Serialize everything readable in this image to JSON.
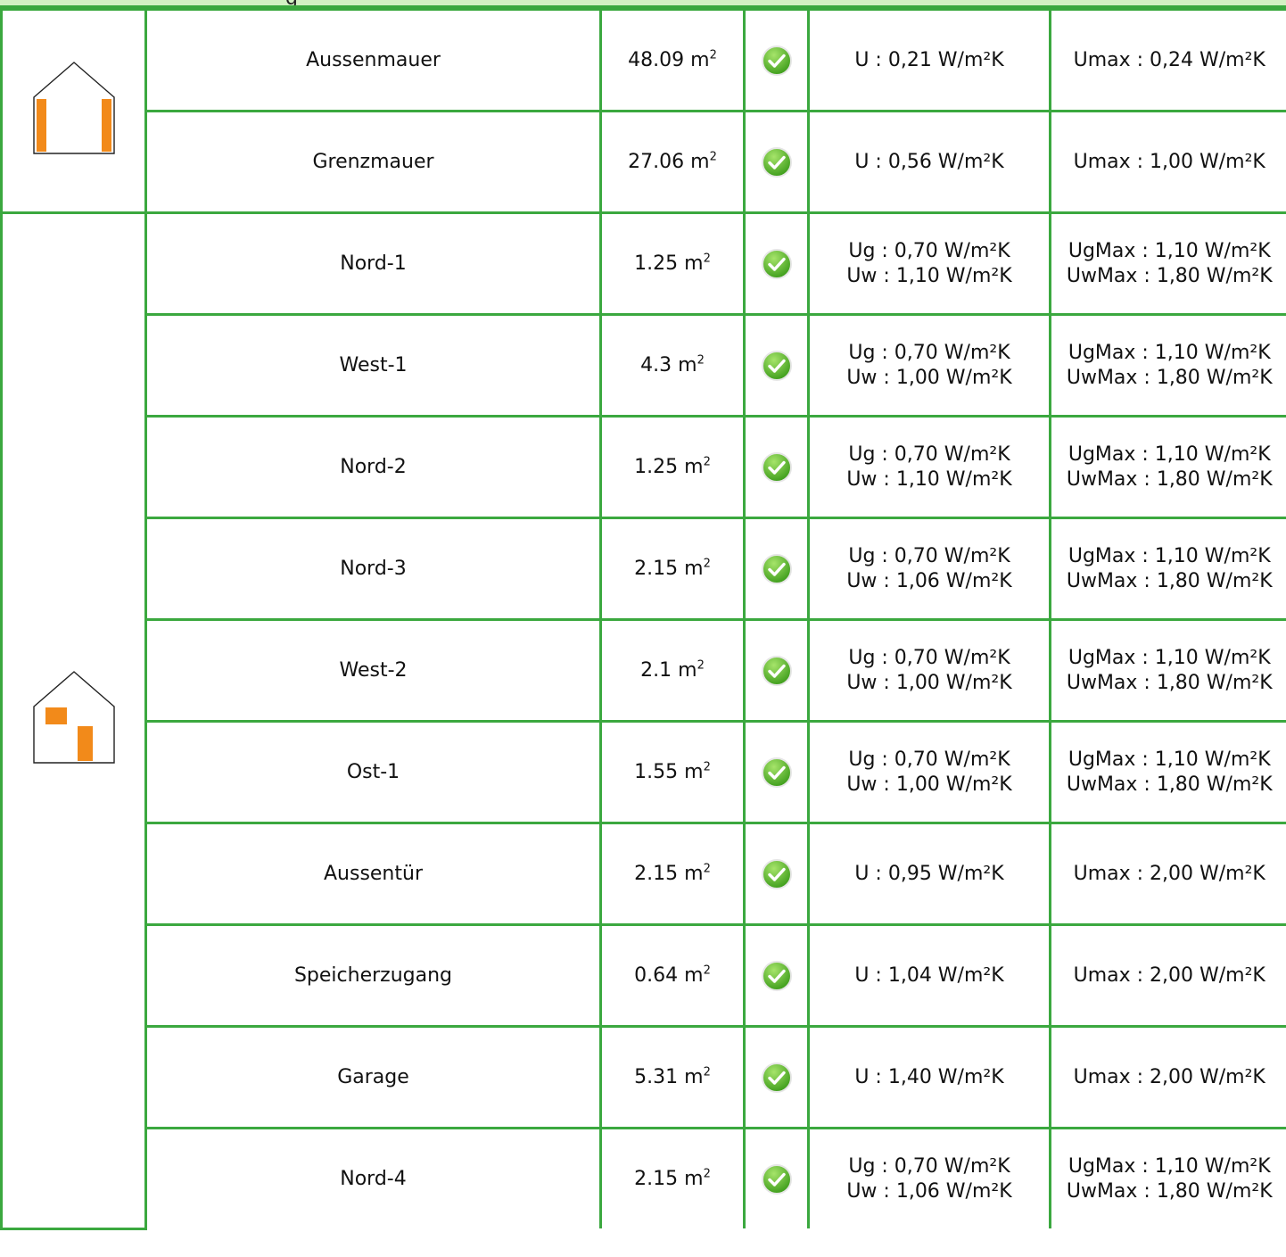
{
  "colors": {
    "grid": "#3ba83f",
    "header_fill": "#d3f1c3",
    "accent_orange": "#f28a1a",
    "check_green": "#5cbf2a"
  },
  "header": {
    "text": "g"
  },
  "groups": [
    {
      "icon": "house-walls-icon",
      "rows": [
        {
          "name": "Aussenmauer",
          "area": "48.09 m",
          "area_unit_sup": "2",
          "value_lines": [
            "U : 0,21 W/m²K"
          ],
          "max_lines": [
            "Umax : 0,24 W/m²K"
          ]
        },
        {
          "name": "Grenzmauer",
          "area": "27.06 m",
          "area_unit_sup": "2",
          "value_lines": [
            "U : 0,56 W/m²K"
          ],
          "max_lines": [
            "Umax : 1,00 W/m²K"
          ]
        }
      ]
    },
    {
      "icon": "house-windows-icon",
      "rows": [
        {
          "name": "Nord-1",
          "area": "1.25 m",
          "area_unit_sup": "2",
          "value_lines": [
            "Ug : 0,70 W/m²K",
            "Uw : 1,10 W/m²K"
          ],
          "max_lines": [
            "UgMax : 1,10 W/m²K",
            "UwMax : 1,80 W/m²K"
          ]
        },
        {
          "name": "West-1",
          "area": "4.3 m",
          "area_unit_sup": "2",
          "value_lines": [
            "Ug : 0,70 W/m²K",
            "Uw : 1,00 W/m²K"
          ],
          "max_lines": [
            "UgMax : 1,10 W/m²K",
            "UwMax : 1,80 W/m²K"
          ]
        },
        {
          "name": "Nord-2",
          "area": "1.25 m",
          "area_unit_sup": "2",
          "value_lines": [
            "Ug : 0,70 W/m²K",
            "Uw : 1,10 W/m²K"
          ],
          "max_lines": [
            "UgMax : 1,10 W/m²K",
            "UwMax : 1,80 W/m²K"
          ]
        },
        {
          "name": "Nord-3",
          "area": "2.15 m",
          "area_unit_sup": "2",
          "value_lines": [
            "Ug : 0,70 W/m²K",
            "Uw : 1,06 W/m²K"
          ],
          "max_lines": [
            "UgMax : 1,10 W/m²K",
            "UwMax : 1,80 W/m²K"
          ]
        },
        {
          "name": "West-2",
          "area": "2.1 m",
          "area_unit_sup": "2",
          "value_lines": [
            "Ug : 0,70 W/m²K",
            "Uw : 1,00 W/m²K"
          ],
          "max_lines": [
            "UgMax : 1,10 W/m²K",
            "UwMax : 1,80 W/m²K"
          ]
        },
        {
          "name": "Ost-1",
          "area": "1.55 m",
          "area_unit_sup": "2",
          "value_lines": [
            "Ug : 0,70 W/m²K",
            "Uw : 1,00 W/m²K"
          ],
          "max_lines": [
            "UgMax : 1,10 W/m²K",
            "UwMax : 1,80 W/m²K"
          ]
        },
        {
          "name": "Aussentür",
          "area": "2.15 m",
          "area_unit_sup": "2",
          "value_lines": [
            "U : 0,95 W/m²K"
          ],
          "max_lines": [
            "Umax : 2,00 W/m²K"
          ]
        },
        {
          "name": "Speicherzugang",
          "area": "0.64 m",
          "area_unit_sup": "2",
          "value_lines": [
            "U : 1,04 W/m²K"
          ],
          "max_lines": [
            "Umax : 2,00 W/m²K"
          ]
        },
        {
          "name": "Garage",
          "area": "5.31 m",
          "area_unit_sup": "2",
          "value_lines": [
            "U : 1,40 W/m²K"
          ],
          "max_lines": [
            "Umax : 2,00 W/m²K"
          ]
        },
        {
          "name": "Nord-4",
          "area": "2.15 m",
          "area_unit_sup": "2",
          "value_lines": [
            "Ug : 0,70 W/m²K",
            "Uw : 1,06 W/m²K"
          ],
          "max_lines": [
            "UgMax : 1,10 W/m²K",
            "UwMax : 1,80 W/m²K"
          ]
        }
      ]
    }
  ],
  "status_icon": "check-circle-icon"
}
